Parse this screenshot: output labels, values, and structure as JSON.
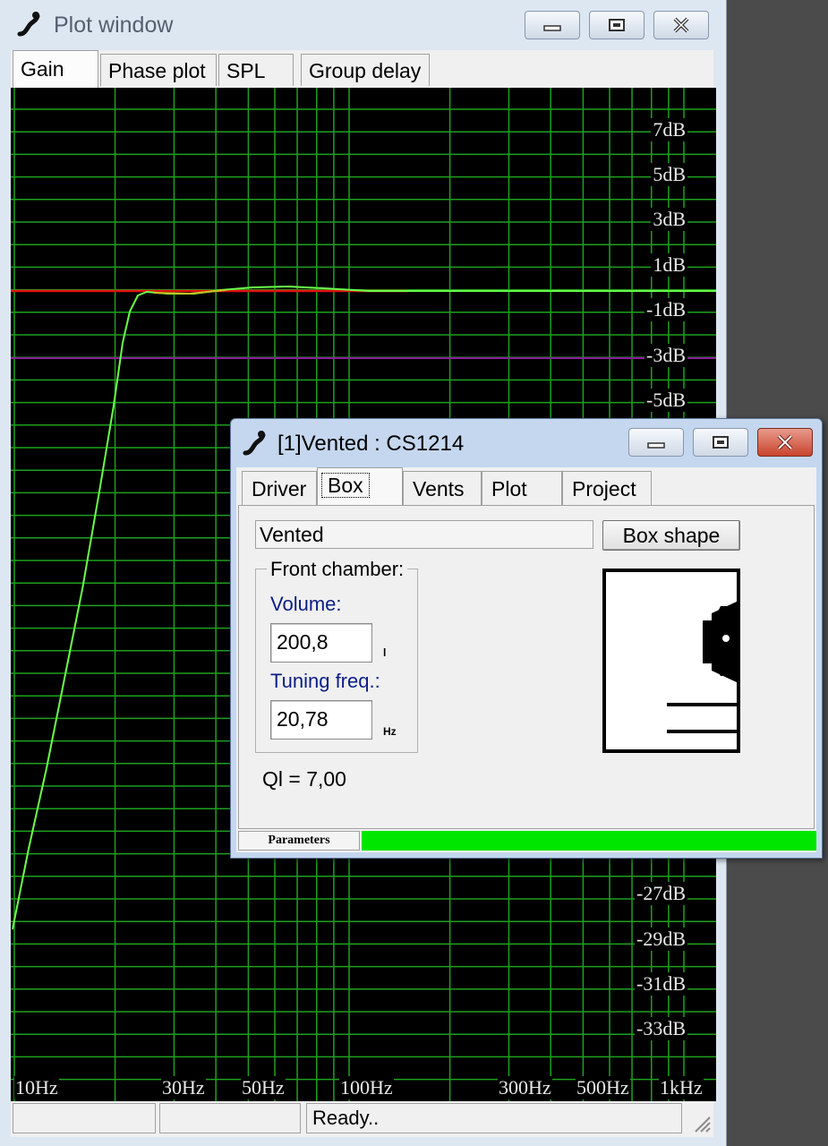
{
  "plot_window": {
    "title": "Plot window",
    "tabs": [
      "Gain",
      "Phase plot",
      "SPL",
      "Group delay"
    ],
    "active_tab": "Gain",
    "y_labels": [
      "7dB",
      "5dB",
      "3dB",
      "1dB",
      "-1dB",
      "-3dB",
      "-5dB",
      "-27dB",
      "-29dB",
      "-31dB",
      "-33dB"
    ],
    "x_labels": [
      "10Hz",
      "30Hz",
      "50Hz",
      "100Hz",
      "300Hz",
      "500Hz",
      "1kHz"
    ],
    "status": [
      "",
      "",
      "Ready.."
    ],
    "colors": {
      "background": "#000000",
      "grid": "#1fa01f",
      "gain_curve": "#6aff4a",
      "reference_line": "#e01010",
      "minus3db_line": "#8b1d9b"
    }
  },
  "dialog": {
    "title": "[1]Vented : CS1214",
    "tabs": [
      "Driver",
      "Box",
      "Vents",
      "Plot",
      "Project"
    ],
    "active_tab": "Box",
    "box_type": "Vented",
    "box_shape_button": "Box shape",
    "front_chamber": {
      "title": "Front chamber:",
      "volume_label": "Volume:",
      "volume_value": "200,8",
      "volume_unit": "l",
      "tuning_label": "Tuning freq.:",
      "tuning_value": "20,78",
      "tuning_unit": "Hz"
    },
    "ql": "Ql = 7,00",
    "status_label": "Parameters",
    "progress": 1.0,
    "progress_color": "#00e600"
  }
}
